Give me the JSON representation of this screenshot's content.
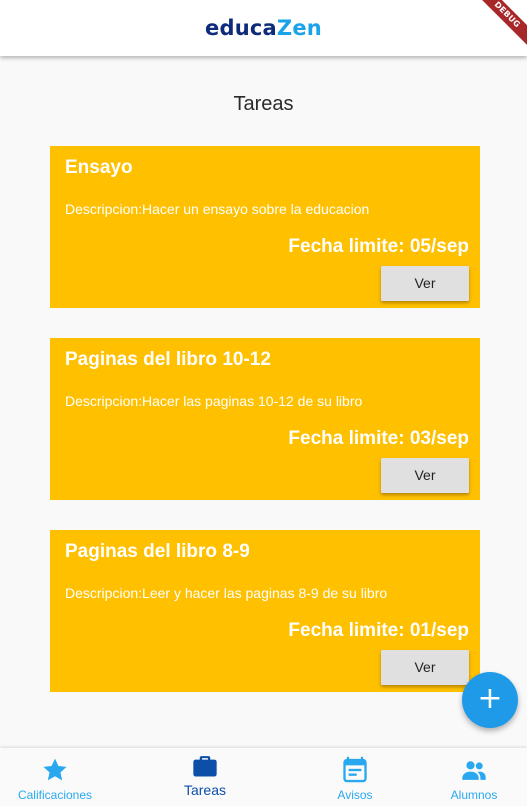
{
  "app": {
    "logo_part1": "educa",
    "logo_part2": "Zen",
    "debug_label": "DEBUG"
  },
  "page": {
    "title": "Tareas"
  },
  "tasks": [
    {
      "title": "Ensayo",
      "description": "Descripcion:Hacer un ensayo sobre la educacion",
      "deadline": "Fecha limite: 05/sep",
      "button_label": "Ver"
    },
    {
      "title": "Paginas del libro 10-12",
      "description": "Descripcion:Hacer las paginas 10-12 de su libro",
      "deadline": "Fecha limite: 03/sep",
      "button_label": "Ver"
    },
    {
      "title": "Paginas del libro 8-9",
      "description": "Descripcion:Leer y hacer las paginas 8-9 de su libro",
      "deadline": "Fecha limite: 01/sep",
      "button_label": "Ver"
    }
  ],
  "fab": {
    "label": "+"
  },
  "bottom_nav": {
    "items": [
      {
        "label": "Calificaciones",
        "icon": "star-icon",
        "active": false
      },
      {
        "label": "Tareas",
        "icon": "briefcase-icon",
        "active": true
      },
      {
        "label": "Avisos",
        "icon": "calendar-icon",
        "active": false
      },
      {
        "label": "Alumnos",
        "icon": "people-icon",
        "active": false
      }
    ]
  },
  "colors": {
    "card": "#ffc000",
    "accent": "#1e9ae8",
    "nav_active": "#0d4fa8",
    "nav_inactive": "#2aa8ef",
    "logo_dark": "#0d2b7a",
    "logo_light": "#1aa3e8"
  }
}
